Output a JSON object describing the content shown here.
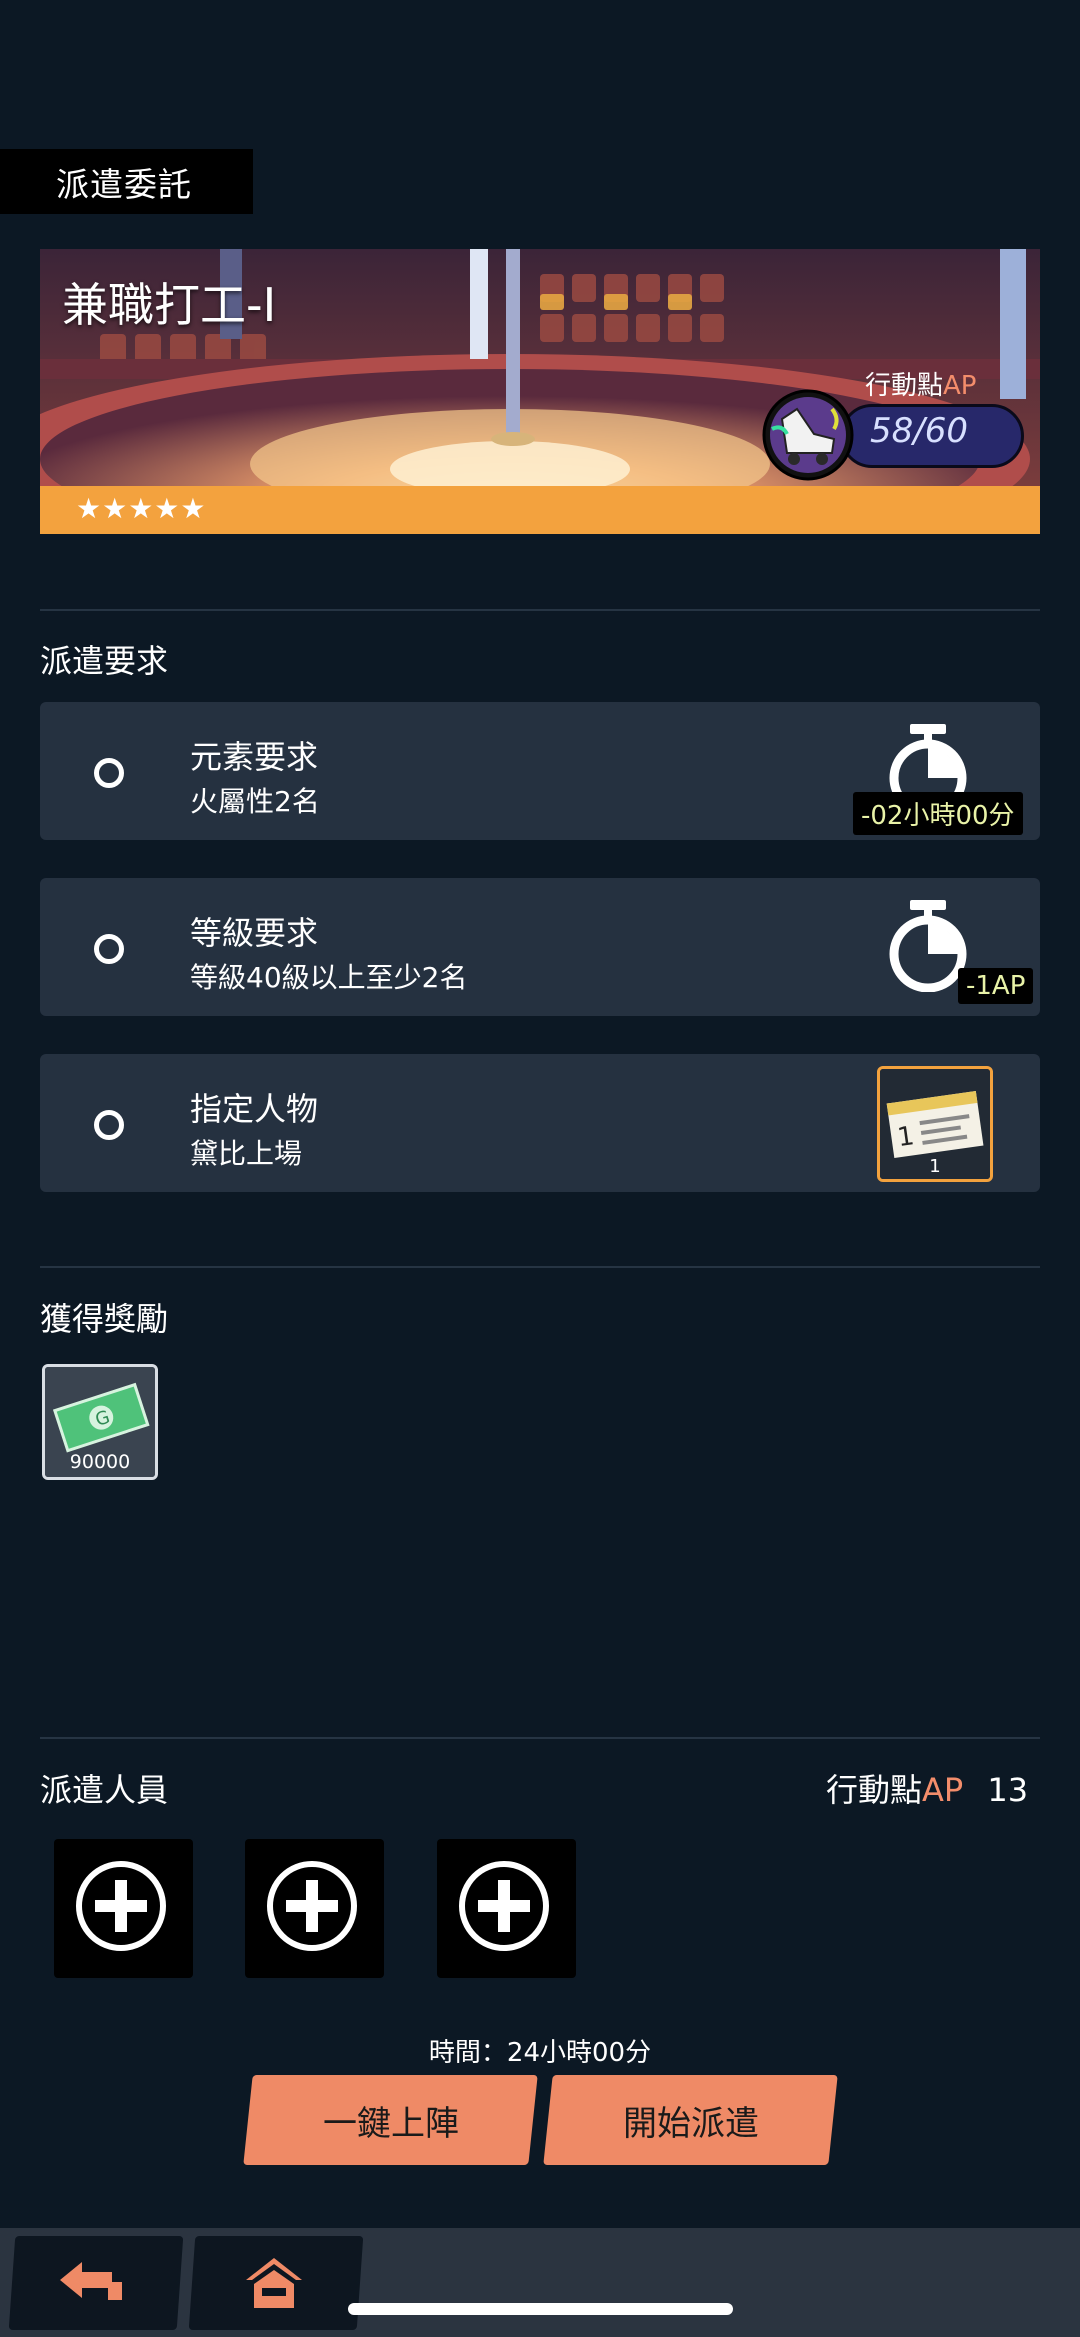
{
  "header": {
    "title": "派遣委託"
  },
  "banner": {
    "title": "兼職打工-I",
    "stars": "★★★★★",
    "ap_label": "行動點",
    "ap_label_suffix": "AP",
    "ap_value": "58/60"
  },
  "requirements": {
    "title": "派遣要求",
    "items": [
      {
        "title": "元素要求",
        "desc": "火屬性2名",
        "badge": "-02小時00分",
        "icon": "stopwatch-icon"
      },
      {
        "title": "等級要求",
        "desc": "等級40級以上至少2名",
        "badge": "-1AP",
        "icon": "stopwatch-icon"
      },
      {
        "title": "指定人物",
        "desc": "黛比上場",
        "badge": "1",
        "icon": "ticket-icon"
      }
    ]
  },
  "rewards": {
    "title": "獲得獎勵",
    "items": [
      {
        "qty": "90000",
        "icon": "banknote-icon"
      }
    ]
  },
  "dispatch": {
    "title": "派遣人員",
    "ap_label": "行動點",
    "ap_suffix": "AP",
    "ap_cost": "13",
    "time": "時間：24小時00分",
    "auto_button": "一鍵上陣",
    "start_button": "開始派遣"
  },
  "colors": {
    "background": "#0c1824",
    "row": "#253140",
    "accent_orange": "#f3a23e",
    "button": "#ef8a66",
    "ap_text": "#f38d6b"
  }
}
